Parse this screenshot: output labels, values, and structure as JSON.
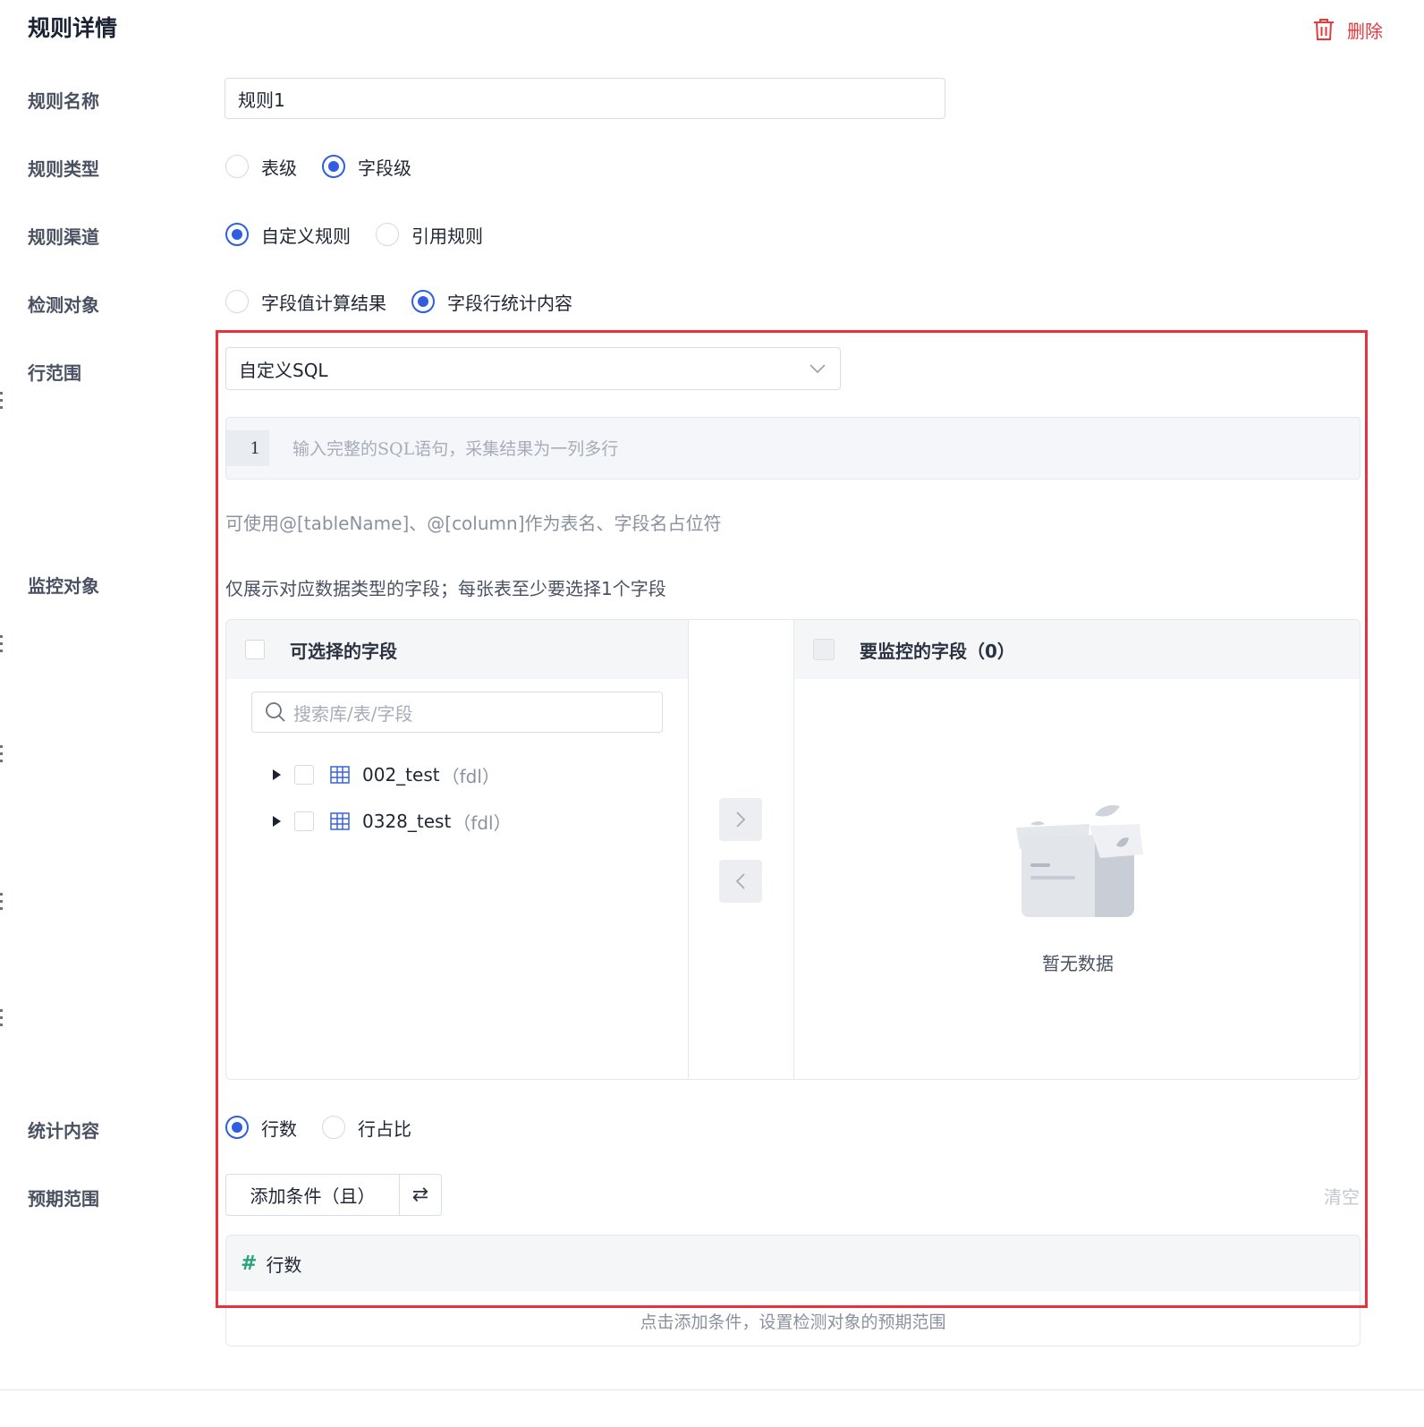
{
  "header": {
    "title": "规则详情",
    "delete_label": "删除"
  },
  "form": {
    "rule_name": {
      "label": "规则名称",
      "value": "规则1"
    },
    "rule_type": {
      "label": "规则类型",
      "options": [
        "表级",
        "字段级"
      ],
      "selected": "字段级"
    },
    "rule_channel": {
      "label": "规则渠道",
      "options": [
        "自定义规则",
        "引用规则"
      ],
      "selected": "自定义规则"
    },
    "detect_object": {
      "label": "检测对象",
      "options": [
        "字段值计算结果",
        "字段行统计内容"
      ],
      "selected": "字段行统计内容"
    },
    "row_range": {
      "label": "行范围",
      "select_value": "自定义SQL",
      "editor_line_number": "1",
      "editor_placeholder": "输入完整的SQL语句，采集结果为一列多行",
      "hint": "可使用@[tableName]、@[column]作为表名、字段名占位符"
    },
    "monitor_object": {
      "label": "监控对象",
      "hint": "仅展示对应数据类型的字段；每张表至少要选择1个字段",
      "left_panel": {
        "title": "可选择的字段",
        "search_placeholder": "搜索库/表/字段",
        "tables": [
          {
            "name": "002_test",
            "schema": "（fdl）"
          },
          {
            "name": "0328_test",
            "schema": "（fdl）"
          }
        ]
      },
      "right_panel": {
        "title": "要监控的字段（0）",
        "empty_text": "暂无数据"
      }
    },
    "stat_content": {
      "label": "统计内容",
      "options": [
        "行数",
        "行占比"
      ],
      "selected": "行数"
    },
    "expected_range": {
      "label": "预期范围",
      "add_condition_label": "添加条件（且）",
      "swap_icon": "⇄",
      "clear_label": "清空",
      "metric_icon": "#",
      "metric_label": "行数",
      "empty_hint": "点击添加条件，设置检测对象的预期范围"
    }
  },
  "colors": {
    "primary": "#2f5ee0",
    "danger": "#e5393c",
    "highlight_border": "#e8313a"
  }
}
